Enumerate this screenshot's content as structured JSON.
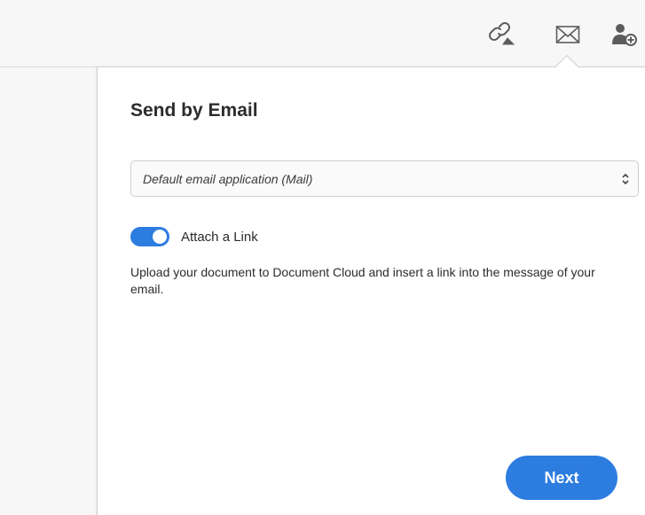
{
  "toolbar": {
    "icons": [
      {
        "name": "link-icon",
        "label": ""
      },
      {
        "name": "email-icon",
        "label": ""
      },
      {
        "name": "add-user-icon",
        "label": ""
      }
    ]
  },
  "panel": {
    "title": "Send by Email",
    "email_app_select": {
      "selected": "Default email application (Mail)"
    },
    "attach_link": {
      "label": "Attach a Link",
      "enabled": true
    },
    "description": "Upload your document to Document Cloud and insert a link into the message of your email.",
    "next_label": "Next"
  },
  "colors": {
    "accent": "#2d7ce0",
    "background": "#f7f7f7",
    "panel": "#ffffff",
    "text": "#2c2c2c",
    "icon": "#5c5c5c"
  }
}
